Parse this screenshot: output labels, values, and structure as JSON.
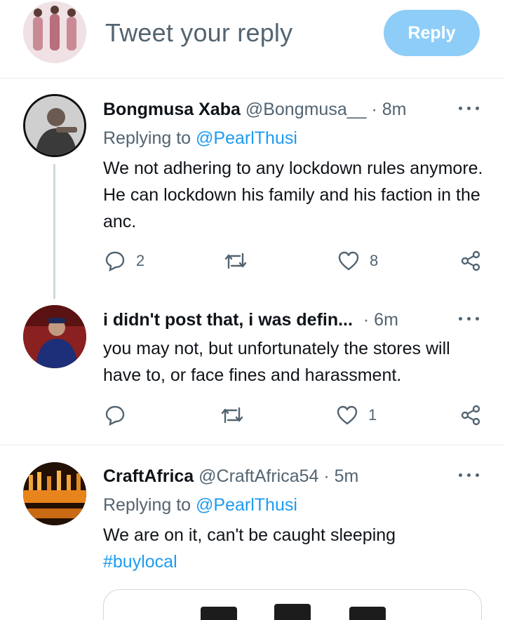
{
  "compose": {
    "placeholder": "Tweet your reply",
    "reply_button": "Reply"
  },
  "tweets": [
    {
      "name": "Bongmusa Xaba",
      "handle": "@Bongmusa__",
      "time": "· 8m",
      "replying_prefix": "Replying to",
      "replying_handle": "@PearlThusi",
      "text": "We not adhering to any lockdown rules anymore. He can lockdown his family and his faction in the anc.",
      "reply_count": "2",
      "retweet_count": "",
      "like_count": "8"
    },
    {
      "name": "i didn't post that, i was defin...",
      "handle": "",
      "time": "· 6m",
      "text": "you may not, but unfortunately the stores will have to, or face fines and harassment.",
      "reply_count": "",
      "retweet_count": "",
      "like_count": "1"
    },
    {
      "name": "CraftAfrica",
      "handle": "@CraftAfrica54",
      "time": "· 5m",
      "replying_prefix": "Replying to",
      "replying_handle": "@PearlThusi",
      "text": "We are on it, can't be caught sleeping",
      "hashtag": "#buylocal"
    }
  ],
  "icons": [
    "reply-icon",
    "retweet-icon",
    "like-icon",
    "share-icon",
    "more-icon"
  ],
  "colors": {
    "accent": "#1d9bf0",
    "reply_button": "#8ecdf8",
    "muted": "#536471"
  }
}
